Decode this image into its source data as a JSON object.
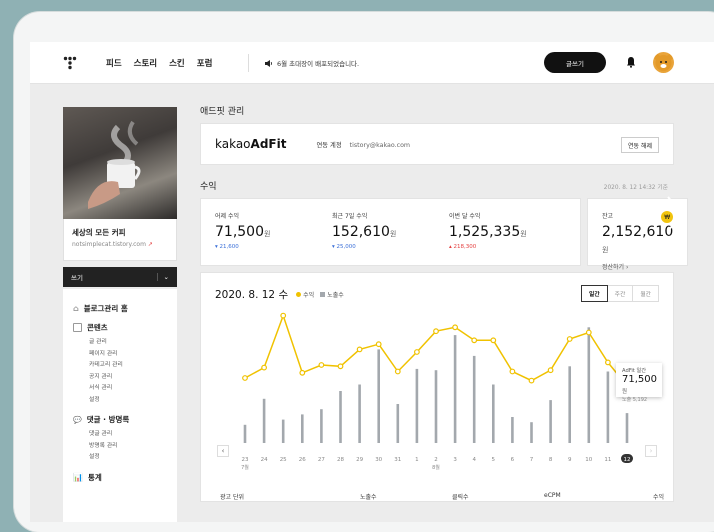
{
  "nav": {
    "items": [
      "피드",
      "스토리",
      "스킨",
      "포럼"
    ],
    "notice": "6월 초대장이 배포되었습니다.",
    "write_btn": "글쓰기"
  },
  "sidebar": {
    "blog_name": "세상의 모든 커피",
    "blog_url": "notsimplecat.tistory.com",
    "write_label": "쓰기",
    "menu": [
      {
        "head": "블로그관리 홈",
        "subs": []
      },
      {
        "head": "콘텐츠",
        "subs": [
          "글 관리",
          "페이지 관리",
          "카테고리 관리",
          "공지 관리",
          "서식 관리",
          "설정"
        ]
      },
      {
        "head": "댓글 · 방명록",
        "subs": [
          "댓글 관리",
          "방명록 관리",
          "설정"
        ]
      },
      {
        "head": "통계",
        "subs": []
      }
    ]
  },
  "adfit": {
    "section_title": "애드핏 관리",
    "logo_light": "kakao",
    "logo_bold": "AdFit",
    "account_label": "연동 계정",
    "account": "tistory@kakao.com",
    "unlink_btn": "연동 해제"
  },
  "revenue": {
    "section_title": "수익",
    "date": "2020. 8. 12 14:32 기준",
    "stats": [
      {
        "label": "어제 수익",
        "value": "71,500",
        "unit": "원",
        "change": "▾ 21,600",
        "dir": "down"
      },
      {
        "label": "최근 7일 수익",
        "value": "152,610",
        "unit": "원",
        "change": "▾ 25,000",
        "dir": "down"
      },
      {
        "label": "이번 달 수익",
        "value": "1,525,335",
        "unit": "원",
        "change": "▴ 218,300",
        "dir": "up"
      }
    ],
    "balance": {
      "label": "잔고",
      "value": "2,152,610",
      "unit": "원",
      "settle": "정산하기 ›",
      "badge": "₩"
    }
  },
  "chart_header": {
    "title": "2020. 8. 12 수",
    "legend_revenue": "수익",
    "legend_impressions": "노출수",
    "tabs": [
      "일간",
      "주간",
      "월간"
    ],
    "active_tab": "일간"
  },
  "chart_data": {
    "type": "line",
    "categories": [
      "23",
      "24",
      "25",
      "26",
      "27",
      "28",
      "29",
      "30",
      "31",
      "1",
      "2",
      "3",
      "4",
      "5",
      "6",
      "7",
      "8",
      "9",
      "10",
      "11",
      "12"
    ],
    "month_labels": {
      "0": "7월",
      "10": "8월"
    },
    "series": [
      {
        "name": "수익",
        "values": [
          50,
          58,
          98,
          54,
          60,
          59,
          72,
          76,
          55,
          70,
          86,
          89,
          79,
          79,
          55,
          48,
          56,
          80,
          85,
          62,
          44
        ],
        "color": "#f0c200"
      },
      {
        "name": "노출수",
        "values": [
          14,
          34,
          18,
          22,
          26,
          40,
          45,
          72,
          30,
          57,
          56,
          83,
          67,
          45,
          20,
          16,
          33,
          59,
          89,
          55,
          23
        ],
        "color": "#a3a8ad"
      }
    ],
    "highlight_index": 20,
    "tooltip": {
      "title": "AdFit 일간",
      "value": "71,500",
      "unit": "원",
      "sub": "노출 5,192"
    }
  },
  "table_head": [
    "광고 단위",
    "노출수",
    "클릭수",
    "eCPM",
    "수익"
  ]
}
